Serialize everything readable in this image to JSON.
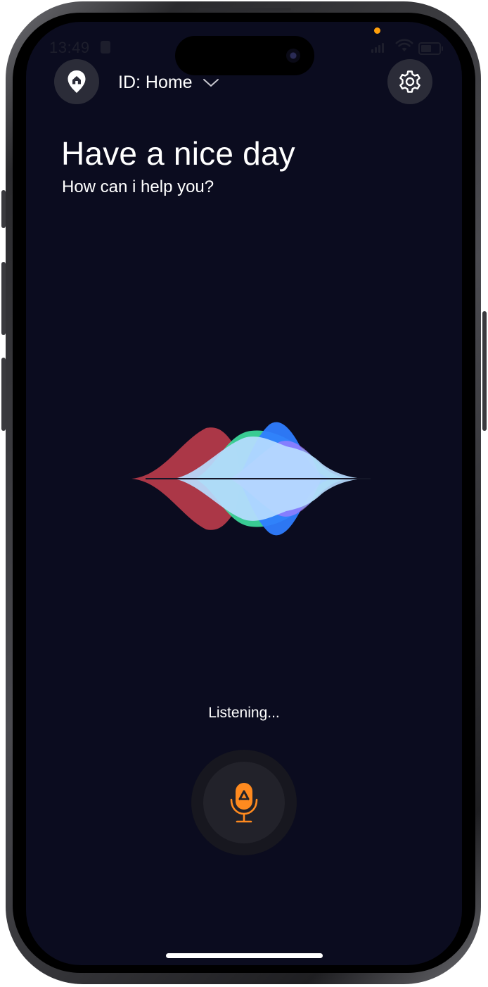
{
  "status_bar": {
    "time": "13:49"
  },
  "header": {
    "id_label": "ID: Home"
  },
  "main": {
    "greeting": "Have a nice day",
    "subgreeting": "How can i help you?",
    "status_text": "Listening..."
  },
  "icons": {
    "home_location": "home-location-pin-icon",
    "settings": "gear-icon",
    "dropdown": "chevron-down-icon",
    "mic": "microphone-icon"
  },
  "colors": {
    "background": "#0b0c1f",
    "accent": "#ff8a1f",
    "button_bg": "#2b2c38",
    "wave_red": "#c8404f",
    "wave_green": "#3ee0a0",
    "wave_blue": "#2f7dff",
    "wave_core": "#b7dcff"
  }
}
